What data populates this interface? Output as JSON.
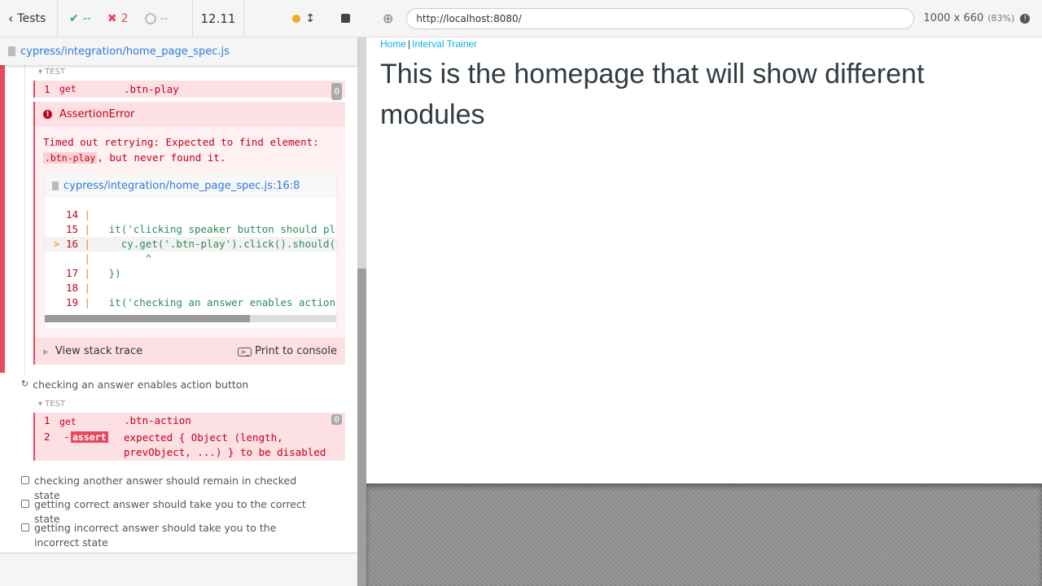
{
  "toolbar": {
    "back_label": "Tests",
    "passed": "--",
    "failed": "2",
    "pending": "--",
    "duration": "12.11"
  },
  "spec_file": "cypress/integration/home_page_spec.js",
  "test1": {
    "section": "TEST",
    "command": {
      "num": "1",
      "name": "get",
      "message": ".btn-play",
      "badge": "0"
    },
    "error": {
      "title": "AssertionError",
      "message_pre": "Timed out retrying: Expected to find element:",
      "code": ".btn-play",
      "message_post": ", but never found it.",
      "file": "cypress/integration/home_page_spec.js:16:8",
      "code_lines": [
        {
          "marker": "",
          "num": "14",
          "text": ""
        },
        {
          "marker": "",
          "num": "15",
          "text": "  it('clicking speaker button should pl"
        },
        {
          "marker": ">",
          "num": "16",
          "text": "    cy.get('.btn-play').click().should("
        },
        {
          "marker": "",
          "num": "",
          "text": "        ^"
        },
        {
          "marker": "",
          "num": "17",
          "text": "  })"
        },
        {
          "marker": "",
          "num": "18",
          "text": ""
        },
        {
          "marker": "",
          "num": "19",
          "text": "  it('checking an answer enables action"
        }
      ],
      "view_stack": "View stack trace",
      "print_console": "Print to console"
    }
  },
  "test2": {
    "title": "checking an answer enables action button",
    "section": "TEST",
    "commands": [
      {
        "num": "1",
        "name": "get",
        "message": ".btn-action",
        "badge": "0"
      },
      {
        "num": "2",
        "name": "assert",
        "message": "expected { Object (length, prevObject, ...) } to be disabled"
      }
    ]
  },
  "pending_tests": [
    "checking another answer should remain in checked state",
    "getting correct answer should take you to the correct state",
    "getting incorrect answer should take you to the incorrect state"
  ],
  "aut": {
    "url": "http://localhost:8080/",
    "viewport": "1000 x 660",
    "scale": "(83%)"
  },
  "app": {
    "nav": [
      "Home",
      "Interval Trainer"
    ],
    "separator": "|",
    "heading": "This is the homepage that will show different modules"
  },
  "colors": {
    "fail": "#e9495d",
    "pass": "#1fa971",
    "link": "#0ab0ea",
    "running": "#f5a623"
  }
}
